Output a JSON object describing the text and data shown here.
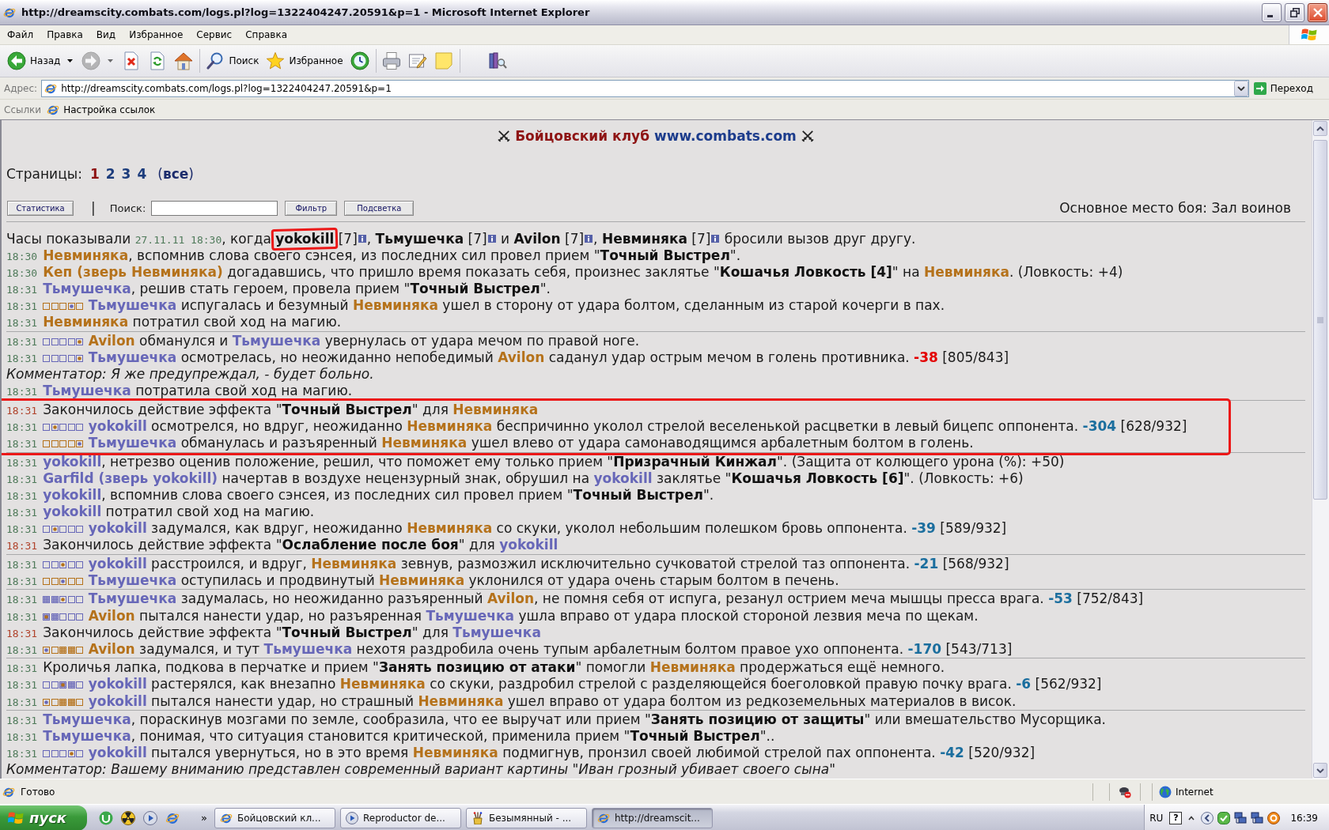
{
  "window": {
    "title": "http://dreamscity.combats.com/logs.pl?log=1322404247.20591&p=1 - Microsoft Internet Explorer"
  },
  "menu": [
    "Файл",
    "Правка",
    "Вид",
    "Избранное",
    "Сервис",
    "Справка"
  ],
  "toolbar": [
    {
      "kind": "back",
      "label": "Назад",
      "dropdown": true,
      "disabled": false
    },
    {
      "kind": "forward",
      "dropdown": true,
      "disabled": true
    },
    {
      "kind": "stop",
      "dropdown": false,
      "disabled": false
    },
    {
      "kind": "refresh",
      "dropdown": false,
      "disabled": false
    },
    {
      "kind": "home",
      "dropdown": false,
      "disabled": false
    },
    {
      "kind": "separator"
    },
    {
      "kind": "search",
      "label": "Поиск",
      "dropdown": false,
      "disabled": false
    },
    {
      "kind": "favorites",
      "label": "Избранное",
      "dropdown": false,
      "disabled": false
    },
    {
      "kind": "history",
      "dropdown": false,
      "disabled": false
    },
    {
      "kind": "separator"
    },
    {
      "kind": "print",
      "dropdown": false,
      "disabled": false
    },
    {
      "kind": "edit",
      "dropdown": false,
      "disabled": false
    },
    {
      "kind": "note",
      "dropdown": false,
      "disabled": false
    },
    {
      "kind": "separator"
    },
    {
      "kind": "research",
      "dropdown": false,
      "disabled": false
    }
  ],
  "address": {
    "label": "Адрес:",
    "url": "http://dreamscity.combats.com/logs.pl?log=1322404247.20591&p=1",
    "go": "Переход"
  },
  "links": {
    "label": "Ссылки",
    "items": [
      "Настройка ссылок"
    ]
  },
  "page": {
    "brand": "Бойцовский клуб",
    "site": "www.combats.com",
    "pages_label": "Страницы:",
    "pages": [
      {
        "label": "1",
        "selected": true
      },
      {
        "label": "2",
        "selected": false
      },
      {
        "label": "3",
        "selected": false
      },
      {
        "label": "4",
        "selected": false
      }
    ],
    "all_pages": "(**все**)",
    "tools": {
      "stats": "Статистика",
      "divider": "|",
      "search_label": "Поиск:",
      "filter": "Фильтр",
      "highlight": "Подсветка"
    },
    "location": "Основное место боя: Зал воинов"
  },
  "log": [
    {
      "marked": false,
      "lines": [
        {
          "kind": "intro",
          "parts": [
            {
              "kind": "text",
              "text": "Часы показывали "
            },
            {
              "kind": "stamp",
              "text": "27.11.11 18:30"
            },
            {
              "kind": "text",
              "text": ", когда "
            },
            {
              "kind": "bold",
              "text": "yokokill",
              "circled": true
            },
            {
              "kind": "text",
              "text": " [7]"
            },
            {
              "kind": "info"
            },
            {
              "kind": "text",
              "text": ", "
            },
            {
              "kind": "bold",
              "text": "Тьмушечка",
              "circled": false
            },
            {
              "kind": "text",
              "text": " [7]"
            },
            {
              "kind": "info"
            },
            {
              "kind": "text",
              "text": " и "
            },
            {
              "kind": "bold",
              "text": "Avilon",
              "circled": false
            },
            {
              "kind": "text",
              "text": " [7]"
            },
            {
              "kind": "info"
            },
            {
              "kind": "text",
              "text": ", "
            },
            {
              "kind": "bold",
              "text": "Невминяка",
              "circled": false
            },
            {
              "kind": "text",
              "text": " [7]"
            },
            {
              "kind": "info"
            },
            {
              "kind": "text",
              "text": " бросили вызов друг другу."
            }
          ]
        },
        {
          "kind": "action",
          "time": "18:30",
          "parts": [
            {
              "kind": "name",
              "text": "Невминяка",
              "color": "#b5721b"
            },
            {
              "kind": "text",
              "text": ", вспомнив слова своего сэнсея, из последних сил провел прием \""
            },
            {
              "kind": "bold",
              "text": "Точный Выстрел"
            },
            {
              "kind": "text",
              "text": "\"."
            }
          ]
        },
        {
          "kind": "action",
          "time": "18:30",
          "parts": [
            {
              "kind": "name",
              "text": "Кеп (зверь Невминяка)",
              "color": "#b5721b"
            },
            {
              "kind": "text",
              "text": " догадавшись, что пришло время показать себя, произнес заклятье \""
            },
            {
              "kind": "bold",
              "text": "Кошачья Ловкость [4]"
            },
            {
              "kind": "text",
              "text": "\" на "
            },
            {
              "kind": "name",
              "text": "Невминяка",
              "color": "#b5721b"
            },
            {
              "kind": "text",
              "text": ". (Ловкость: +4)"
            }
          ]
        },
        {
          "kind": "action",
          "time": "18:31",
          "parts": [
            {
              "kind": "name",
              "text": "Тьмушечка",
              "color": "#6767b8"
            },
            {
              "kind": "text",
              "text": ", решив стать героем, провела прием \""
            },
            {
              "kind": "bold",
              "text": "Точный Выстрел"
            },
            {
              "kind": "text",
              "text": "\"."
            }
          ]
        },
        {
          "kind": "action",
          "time": "18:31",
          "zones": {
            "color": "#b5721b",
            "cells": [
              {
                "kind": "empty"
              },
              {
                "kind": "empty"
              },
              {
                "kind": "empty"
              },
              {
                "kind": "hit",
                "color": "#6767b8"
              },
              {
                "kind": "empty"
              }
            ]
          },
          "parts": [
            {
              "kind": "name",
              "text": "Тьмушечка",
              "color": "#6767b8"
            },
            {
              "kind": "text",
              "text": " испугалась и безумный "
            },
            {
              "kind": "name",
              "text": "Невминяка",
              "color": "#b5721b"
            },
            {
              "kind": "text",
              "text": " ушел в сторону от удара болтом, сделанным из старой кочерги в пах."
            }
          ]
        },
        {
          "kind": "action",
          "time": "18:31",
          "parts": [
            {
              "kind": "name",
              "text": "Невминяка",
              "color": "#b5721b"
            },
            {
              "kind": "text",
              "text": " потратил свой ход на магию."
            }
          ]
        }
      ]
    },
    {
      "marked": false,
      "lines": [
        {
          "kind": "action",
          "time": "18:31",
          "zones": {
            "color": "#6767b8",
            "cells": [
              {
                "kind": "empty"
              },
              {
                "kind": "empty"
              },
              {
                "kind": "empty"
              },
              {
                "kind": "empty"
              },
              {
                "kind": "hit",
                "color": "#b5721b"
              }
            ]
          },
          "parts": [
            {
              "kind": "name",
              "text": "Avilon",
              "color": "#b5721b"
            },
            {
              "kind": "text",
              "text": " обманулся и "
            },
            {
              "kind": "name",
              "text": "Тьмушечка",
              "color": "#6767b8"
            },
            {
              "kind": "text",
              "text": " увернулась от удара мечом по правой ноге."
            }
          ]
        },
        {
          "kind": "action",
          "time": "18:31",
          "zones": {
            "color": "#6767b8",
            "cells": [
              {
                "kind": "empty"
              },
              {
                "kind": "empty"
              },
              {
                "kind": "empty"
              },
              {
                "kind": "empty"
              },
              {
                "kind": "hit",
                "color": "#b5721b"
              }
            ]
          },
          "parts": [
            {
              "kind": "name",
              "text": "Тьмушечка",
              "color": "#6767b8"
            },
            {
              "kind": "text",
              "text": " осмотрелась, но неожиданно непобедимый "
            },
            {
              "kind": "name",
              "text": "Avilon",
              "color": "#b5721b"
            },
            {
              "kind": "text",
              "text": " саданул удар острым мечом в голень противника. "
            },
            {
              "kind": "damage",
              "text": "-38",
              "color": "#e30000"
            },
            {
              "kind": "text",
              "text": " [805/843]"
            }
          ]
        },
        {
          "kind": "comment",
          "parts": [
            {
              "kind": "text",
              "text": "Комментатор: Я же предупреждал, - будет больно."
            }
          ]
        },
        {
          "kind": "action",
          "time": "18:31",
          "parts": [
            {
              "kind": "name",
              "text": "Тьмушечка",
              "color": "#6767b8"
            },
            {
              "kind": "text",
              "text": " потратила свой ход на магию."
            }
          ]
        }
      ]
    },
    {
      "marked": true,
      "lines": [
        {
          "kind": "effect",
          "time": "18:31",
          "parts": [
            {
              "kind": "text",
              "text": "Закончилось действие эффекта \""
            },
            {
              "kind": "bold",
              "text": "Точный Выстрел"
            },
            {
              "kind": "text",
              "text": "\" для "
            },
            {
              "kind": "name",
              "text": "Невминяка",
              "color": "#b5721b"
            }
          ]
        },
        {
          "kind": "action",
          "time": "18:31",
          "zones": {
            "color": "#6767b8",
            "cells": [
              {
                "kind": "empty"
              },
              {
                "kind": "hit",
                "color": "#b5721b"
              },
              {
                "kind": "empty"
              },
              {
                "kind": "empty"
              },
              {
                "kind": "empty"
              }
            ]
          },
          "parts": [
            {
              "kind": "name",
              "text": "yokokill",
              "color": "#6767b8"
            },
            {
              "kind": "text",
              "text": " осмотрелся, но вдруг, неожиданно "
            },
            {
              "kind": "name",
              "text": "Невминяка",
              "color": "#b5721b"
            },
            {
              "kind": "text",
              "text": " беспричинно уколол стрелой веселенькой расцветки в левый бицепс оппонента. "
            },
            {
              "kind": "damage",
              "text": "-304",
              "color": "#1b6e9e"
            },
            {
              "kind": "text",
              "text": " [628/932]"
            }
          ]
        },
        {
          "kind": "action",
          "time": "18:31",
          "zones": {
            "color": "#b5721b",
            "cells": [
              {
                "kind": "empty"
              },
              {
                "kind": "empty"
              },
              {
                "kind": "empty"
              },
              {
                "kind": "empty"
              },
              {
                "kind": "hit",
                "color": "#6767b8"
              }
            ]
          },
          "parts": [
            {
              "kind": "name",
              "text": "Тьмушечка",
              "color": "#6767b8"
            },
            {
              "kind": "text",
              "text": " обманулась и разъяренный "
            },
            {
              "kind": "name",
              "text": "Невминяка",
              "color": "#b5721b"
            },
            {
              "kind": "text",
              "text": " ушел влево от удара самонаводящимся арбалетным болтом в голень."
            }
          ]
        }
      ]
    },
    {
      "marked": false,
      "lines": [
        {
          "kind": "action",
          "time": "18:31",
          "parts": [
            {
              "kind": "name",
              "text": "yokokill",
              "color": "#6767b8"
            },
            {
              "kind": "text",
              "text": ", нетрезво оценив положение, решил, что поможет ему только прием \""
            },
            {
              "kind": "bold",
              "text": "Призрачный Кинжал"
            },
            {
              "kind": "text",
              "text": "\". (Защита от колющего урона (%): +50)"
            }
          ]
        },
        {
          "kind": "action",
          "time": "18:31",
          "parts": [
            {
              "kind": "name",
              "text": "Garfild (зверь yokokill)",
              "color": "#6767b8"
            },
            {
              "kind": "text",
              "text": " начертав в воздухе нецензурный знак, обрушил на "
            },
            {
              "kind": "name",
              "text": "yokokill",
              "color": "#6767b8"
            },
            {
              "kind": "text",
              "text": " заклятье \""
            },
            {
              "kind": "bold",
              "text": "Кошачья Ловкость [6]"
            },
            {
              "kind": "text",
              "text": "\". (Ловкость: +6)"
            }
          ]
        },
        {
          "kind": "action",
          "time": "18:31",
          "parts": [
            {
              "kind": "name",
              "text": "yokokill",
              "color": "#6767b8"
            },
            {
              "kind": "text",
              "text": ", вспомнив слова своего сэнсея, из последних сил провел прием \""
            },
            {
              "kind": "bold",
              "text": "Точный Выстрел"
            },
            {
              "kind": "text",
              "text": "\"."
            }
          ]
        },
        {
          "kind": "action",
          "time": "18:31",
          "parts": [
            {
              "kind": "name",
              "text": "yokokill",
              "color": "#6767b8"
            },
            {
              "kind": "text",
              "text": " потратил свой ход на магию."
            }
          ]
        },
        {
          "kind": "action",
          "time": "18:31",
          "zones": {
            "color": "#6767b8",
            "cells": [
              {
                "kind": "empty"
              },
              {
                "kind": "hit",
                "color": "#b5721b"
              },
              {
                "kind": "empty"
              },
              {
                "kind": "empty"
              },
              {
                "kind": "empty"
              }
            ]
          },
          "parts": [
            {
              "kind": "name",
              "text": "yokokill",
              "color": "#6767b8"
            },
            {
              "kind": "text",
              "text": " задумался, как вдруг, неожиданно "
            },
            {
              "kind": "name",
              "text": "Невминяка",
              "color": "#b5721b"
            },
            {
              "kind": "text",
              "text": " со скуки, уколол небольшим полешком бровь оппонента. "
            },
            {
              "kind": "damage",
              "text": "-39",
              "color": "#1b6e9e"
            },
            {
              "kind": "text",
              "text": " [589/932]"
            }
          ]
        },
        {
          "kind": "effect",
          "time": "18:31",
          "parts": [
            {
              "kind": "text",
              "text": "Закончилось действие эффекта \""
            },
            {
              "kind": "bold",
              "text": "Ослабление после боя"
            },
            {
              "kind": "text",
              "text": "\" для "
            },
            {
              "kind": "name",
              "text": "yokokill",
              "color": "#6767b8"
            }
          ]
        }
      ]
    },
    {
      "marked": false,
      "lines": [
        {
          "kind": "action",
          "time": "18:31",
          "zones": {
            "color": "#6767b8",
            "cells": [
              {
                "kind": "empty"
              },
              {
                "kind": "empty"
              },
              {
                "kind": "hit",
                "color": "#b5721b"
              },
              {
                "kind": "empty"
              },
              {
                "kind": "empty"
              }
            ]
          },
          "parts": [
            {
              "kind": "name",
              "text": "yokokill",
              "color": "#6767b8"
            },
            {
              "kind": "text",
              "text": " расстроился, и вдруг, "
            },
            {
              "kind": "name",
              "text": "Невминяка",
              "color": "#b5721b"
            },
            {
              "kind": "text",
              "text": " зевнув, размозжил исключительно сучковатой стрелой таз оппонента. "
            },
            {
              "kind": "damage",
              "text": "-21",
              "color": "#1b6e9e"
            },
            {
              "kind": "text",
              "text": " [568/932]"
            }
          ]
        },
        {
          "kind": "action",
          "time": "18:31",
          "zones": {
            "color": "#b5721b",
            "cells": [
              {
                "kind": "empty"
              },
              {
                "kind": "empty"
              },
              {
                "kind": "hit",
                "color": "#6767b8"
              },
              {
                "kind": "empty"
              },
              {
                "kind": "empty"
              }
            ]
          },
          "parts": [
            {
              "kind": "name",
              "text": "Тьмушечка",
              "color": "#6767b8"
            },
            {
              "kind": "text",
              "text": " оступилась и продвинутый "
            },
            {
              "kind": "name",
              "text": "Невминяка",
              "color": "#b5721b"
            },
            {
              "kind": "text",
              "text": " уклонился от удара очень старым болтом в печень."
            }
          ]
        }
      ]
    },
    {
      "marked": false,
      "lines": [
        {
          "kind": "action",
          "time": "18:31",
          "zones": {
            "color": "#6767b8",
            "cells": [
              {
                "kind": "block"
              },
              {
                "kind": "block"
              },
              {
                "kind": "hit",
                "color": "#b5721b"
              },
              {
                "kind": "empty"
              },
              {
                "kind": "empty"
              }
            ]
          },
          "parts": [
            {
              "kind": "name",
              "text": "Тьмушечка",
              "color": "#6767b8"
            },
            {
              "kind": "text",
              "text": " задумалась, но неожиданно разъяренный "
            },
            {
              "kind": "name",
              "text": "Avilon",
              "color": "#b5721b"
            },
            {
              "kind": "text",
              "text": ", не помня себя от испуга, резанул острием меча мышцы пресса врага. "
            },
            {
              "kind": "damage",
              "text": "-53",
              "color": "#1b6e9e"
            },
            {
              "kind": "text",
              "text": " [752/843]"
            }
          ]
        },
        {
          "kind": "action",
          "time": "18:31",
          "zones": {
            "color": "#6767b8",
            "cells": [
              {
                "kind": "hit_block",
                "color": "#b5721b"
              },
              {
                "kind": "block"
              },
              {
                "kind": "empty"
              },
              {
                "kind": "empty"
              },
              {
                "kind": "empty"
              }
            ]
          },
          "parts": [
            {
              "kind": "name",
              "text": "Avilon",
              "color": "#b5721b"
            },
            {
              "kind": "text",
              "text": " пытался нанести удар, но разъяренная "
            },
            {
              "kind": "name",
              "text": "Тьмушечка",
              "color": "#6767b8"
            },
            {
              "kind": "text",
              "text": " ушла вправо от удара плоской стороной лезвия меча по щекам."
            }
          ]
        },
        {
          "kind": "effect",
          "time": "18:31",
          "parts": [
            {
              "kind": "text",
              "text": "Закончилось действие эффекта \""
            },
            {
              "kind": "bold",
              "text": "Точный Выстрел"
            },
            {
              "kind": "text",
              "text": "\" для "
            },
            {
              "kind": "name",
              "text": "Тьмушечка",
              "color": "#6767b8"
            }
          ]
        },
        {
          "kind": "action",
          "time": "18:31",
          "zones": {
            "color": "#b5721b",
            "cells": [
              {
                "kind": "hit",
                "color": "#6767b8"
              },
              {
                "kind": "empty"
              },
              {
                "kind": "block"
              },
              {
                "kind": "block"
              },
              {
                "kind": "empty"
              }
            ]
          },
          "parts": [
            {
              "kind": "name",
              "text": "Avilon",
              "color": "#b5721b"
            },
            {
              "kind": "text",
              "text": " задумался, и тут "
            },
            {
              "kind": "name",
              "text": "Тьмушечка",
              "color": "#6767b8"
            },
            {
              "kind": "text",
              "text": " нехотя раздробила очень тупым арбалетным болтом правое ухо оппонента. "
            },
            {
              "kind": "damage",
              "text": "-170",
              "color": "#1b6e9e"
            },
            {
              "kind": "text",
              "text": " [543/713]"
            }
          ]
        }
      ]
    },
    {
      "marked": false,
      "lines": [
        {
          "kind": "action",
          "time": "18:31",
          "parts": [
            {
              "kind": "text",
              "text": "Кроличья лапка, подкова в перчатке и прием \""
            },
            {
              "kind": "bold",
              "text": "Занять позицию от атаки"
            },
            {
              "kind": "text",
              "text": "\" помогли "
            },
            {
              "kind": "name",
              "text": "Невминяка",
              "color": "#b5721b"
            },
            {
              "kind": "text",
              "text": " продержаться ещё немного."
            }
          ]
        },
        {
          "kind": "action",
          "time": "18:31",
          "zones": {
            "color": "#6767b8",
            "cells": [
              {
                "kind": "empty"
              },
              {
                "kind": "empty"
              },
              {
                "kind": "hit_block",
                "color": "#b5721b"
              },
              {
                "kind": "block"
              },
              {
                "kind": "empty"
              }
            ]
          },
          "parts": [
            {
              "kind": "name",
              "text": "yokokill",
              "color": "#6767b8"
            },
            {
              "kind": "text",
              "text": " растерялся, как внезапно "
            },
            {
              "kind": "name",
              "text": "Невминяка",
              "color": "#b5721b"
            },
            {
              "kind": "text",
              "text": " со скуки, раздробил стрелой с разделяющейся боеголовкой правую почку врага. "
            },
            {
              "kind": "damage",
              "text": "-6",
              "color": "#1b6e9e"
            },
            {
              "kind": "text",
              "text": " [562/932]"
            }
          ]
        },
        {
          "kind": "action",
          "time": "18:31",
          "zones": {
            "color": "#b5721b",
            "cells": [
              {
                "kind": "hit",
                "color": "#6767b8"
              },
              {
                "kind": "empty"
              },
              {
                "kind": "block"
              },
              {
                "kind": "block"
              },
              {
                "kind": "empty"
              }
            ]
          },
          "parts": [
            {
              "kind": "name",
              "text": "yokokill",
              "color": "#6767b8"
            },
            {
              "kind": "text",
              "text": " пытался нанести удар, но страшный "
            },
            {
              "kind": "name",
              "text": "Невминяка",
              "color": "#b5721b"
            },
            {
              "kind": "text",
              "text": " ушел вправо от удара болтом из редкоземельных материалов в висок."
            }
          ]
        }
      ]
    },
    {
      "marked": false,
      "lines": [
        {
          "kind": "action",
          "time": "18:31",
          "parts": [
            {
              "kind": "name",
              "text": "Тьмушечка",
              "color": "#6767b8"
            },
            {
              "kind": "text",
              "text": ", пораскинув мозгами по земле, сообразила, что ее выручат или прием \""
            },
            {
              "kind": "bold",
              "text": "Занять позицию от защиты"
            },
            {
              "kind": "text",
              "text": "\" или вмешательство Мусорщика."
            }
          ]
        },
        {
          "kind": "action",
          "time": "18:31",
          "parts": [
            {
              "kind": "name",
              "text": "Тьмушечка",
              "color": "#6767b8"
            },
            {
              "kind": "text",
              "text": ", понимая, что ситуация становится критической, применила прием \""
            },
            {
              "kind": "bold",
              "text": "Точный Выстрел"
            },
            {
              "kind": "text",
              "text": "\".."
            }
          ]
        },
        {
          "kind": "action",
          "time": "18:31",
          "zones": {
            "color": "#6767b8",
            "cells": [
              {
                "kind": "empty"
              },
              {
                "kind": "empty"
              },
              {
                "kind": "empty"
              },
              {
                "kind": "hit",
                "color": "#b5721b"
              },
              {
                "kind": "empty"
              }
            ]
          },
          "parts": [
            {
              "kind": "name",
              "text": "yokokill",
              "color": "#6767b8"
            },
            {
              "kind": "text",
              "text": " пытался увернуться, но в это время "
            },
            {
              "kind": "name",
              "text": "Невминяка",
              "color": "#b5721b"
            },
            {
              "kind": "text",
              "text": " подмигнув, пронзил своей любимой стрелой пах оппонента. "
            },
            {
              "kind": "damage",
              "text": "-42",
              "color": "#1b6e9e"
            },
            {
              "kind": "text",
              "text": " [520/932]"
            }
          ]
        },
        {
          "kind": "comment",
          "parts": [
            {
              "kind": "text",
              "text": "Комментатор: Вашему вниманию представлен современный вариант картины \"Иван грозный убивает своего сына\""
            }
          ]
        }
      ]
    }
  ],
  "status_bar": {
    "text": "Готово",
    "zone": "Internet"
  },
  "taskbar": {
    "start": "пуск",
    "quick_launch": [
      {
        "kind": "torrent"
      },
      {
        "kind": "hazard"
      },
      {
        "kind": "player"
      },
      {
        "kind": "browser"
      }
    ],
    "more": "»",
    "tasks": [
      {
        "kind": "browser",
        "label": "Бойцовский кл...",
        "selected": false
      },
      {
        "kind": "player",
        "label": "Reproductor de...",
        "selected": false
      },
      {
        "kind": "paint",
        "label": "Безымянный - ...",
        "selected": false
      },
      {
        "kind": "browser",
        "label": "http://dreamscit...",
        "selected": true
      }
    ],
    "tray": {
      "language": "RU",
      "help": "?",
      "clock": "16:39"
    }
  }
}
